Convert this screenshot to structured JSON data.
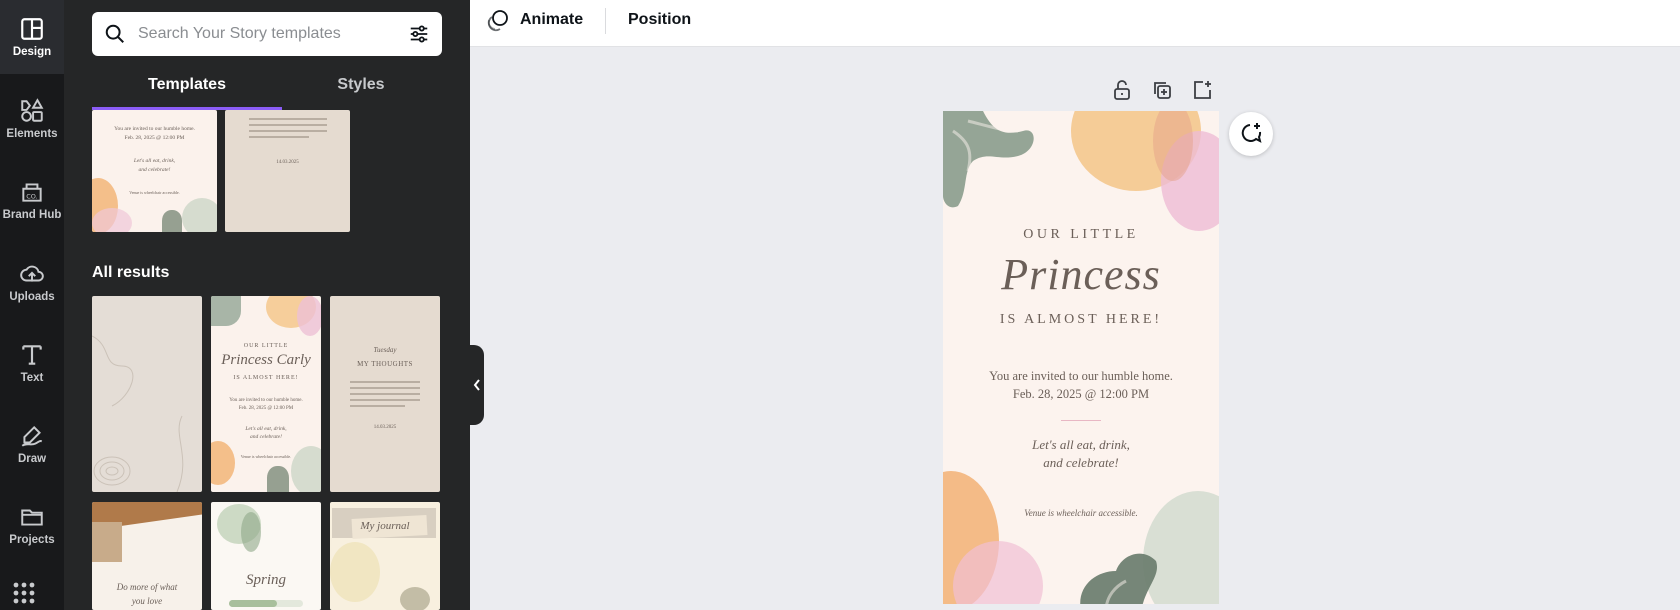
{
  "rail": {
    "items": [
      {
        "label": "Design",
        "icon": "layout-icon"
      },
      {
        "label": "Elements",
        "icon": "shapes-icon"
      },
      {
        "label": "Brand Hub",
        "icon": "brand-icon"
      },
      {
        "label": "Uploads",
        "icon": "cloud-upload-icon"
      },
      {
        "label": "Text",
        "icon": "text-icon"
      },
      {
        "label": "Draw",
        "icon": "draw-icon"
      },
      {
        "label": "Projects",
        "icon": "folder-icon"
      }
    ],
    "brand_badge": "CO."
  },
  "search": {
    "placeholder": "Search Your Story templates"
  },
  "tabs": {
    "templates": "Templates",
    "styles": "Styles"
  },
  "section": {
    "all_results": "All results"
  },
  "thumbs": {
    "top1": {
      "line1": "You are invited to our humble home.",
      "line2": "Feb. 28, 2025 @ 12:00 PM",
      "line3": "Let's all eat, drink,",
      "line4": "and celebrate!",
      "line5": "Venue is wheelchair accessible."
    },
    "top2": {
      "date": "14.03.2025"
    },
    "r1b": {
      "l1": "OUR LITTLE",
      "l2": "Princess Carly",
      "l3": "IS ALMOST HERE!",
      "l4": "You are invited to our humble home.",
      "l5": "Feb. 28, 2025 @ 12:00 PM",
      "l6": "Let's all eat, drink,",
      "l7": "and celebrate!",
      "l8": "Venue is wheelchair accessible."
    },
    "r1c": {
      "l1": "Tuesday",
      "l2": "MY THOUGHTS",
      "l3": "14.03.2025"
    },
    "r2a": {
      "l1": "Do more of what",
      "l2": "you love"
    },
    "r2b": {
      "l1": "Spring"
    },
    "r2c": {
      "l1": "My journal"
    }
  },
  "toolbar": {
    "animate": "Animate",
    "position": "Position"
  },
  "design": {
    "line1": "OUR LITTLE",
    "line2": "Princess",
    "line3": "IS ALMOST HERE!",
    "line4": "You are invited to our humble home.",
    "line5": "Feb. 28, 2025 @ 12:00 PM",
    "line6": "Let's all eat, drink,",
    "line7": "and celebrate!",
    "line8": "Venue is wheelchair accessible."
  },
  "colors": {
    "rail_bg": "#18191b",
    "panel_bg": "#252627",
    "accent": "#8b5cf6",
    "canvas_bg": "#ebecf0",
    "design_bg": "#fcf3ee"
  }
}
